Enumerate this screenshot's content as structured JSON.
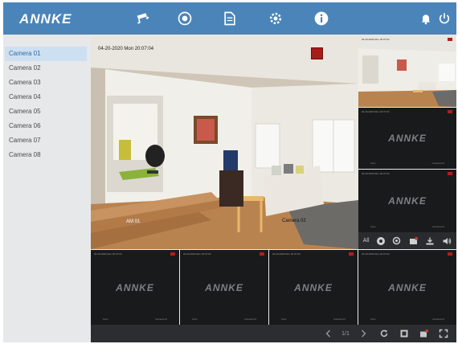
{
  "app": {
    "logo": "ANNKE"
  },
  "nav": {
    "items": [
      {
        "name": "camera-nav",
        "icon": "security-camera-icon"
      },
      {
        "name": "playback-nav",
        "icon": "record-disc-icon"
      },
      {
        "name": "files-nav",
        "icon": "file-icon"
      },
      {
        "name": "settings-nav",
        "icon": "gear-icon"
      },
      {
        "name": "info-nav",
        "icon": "info-icon"
      }
    ],
    "right": [
      {
        "name": "alarm",
        "icon": "bell-icon"
      },
      {
        "name": "power",
        "icon": "power-icon"
      }
    ]
  },
  "sidebar": {
    "cameras": [
      {
        "label": "Camera 01",
        "active": true
      },
      {
        "label": "Camera 02"
      },
      {
        "label": "Camera 03"
      },
      {
        "label": "Camera 04"
      },
      {
        "label": "Camera 05"
      },
      {
        "label": "Camera 06"
      },
      {
        "label": "Camera 07"
      },
      {
        "label": "Camera 08"
      }
    ]
  },
  "main_view": {
    "timestamp": "04-20-2020  Mon  20:07:04",
    "label_left": "AM 01",
    "label_right": "Camera 02"
  },
  "tiles": {
    "logo": "ANNKE",
    "timestamp": "04-20-2020 Mon 20:07:04",
    "label_left": "Cam",
    "label_right": "Camera 01"
  },
  "right_toolbar": {
    "all_label": "All"
  },
  "bottom_bar": {
    "page": "1/1"
  },
  "colors": {
    "accent": "#4b84b9",
    "panel_dark": "#191a1c",
    "rec_red": "#b21f18"
  }
}
